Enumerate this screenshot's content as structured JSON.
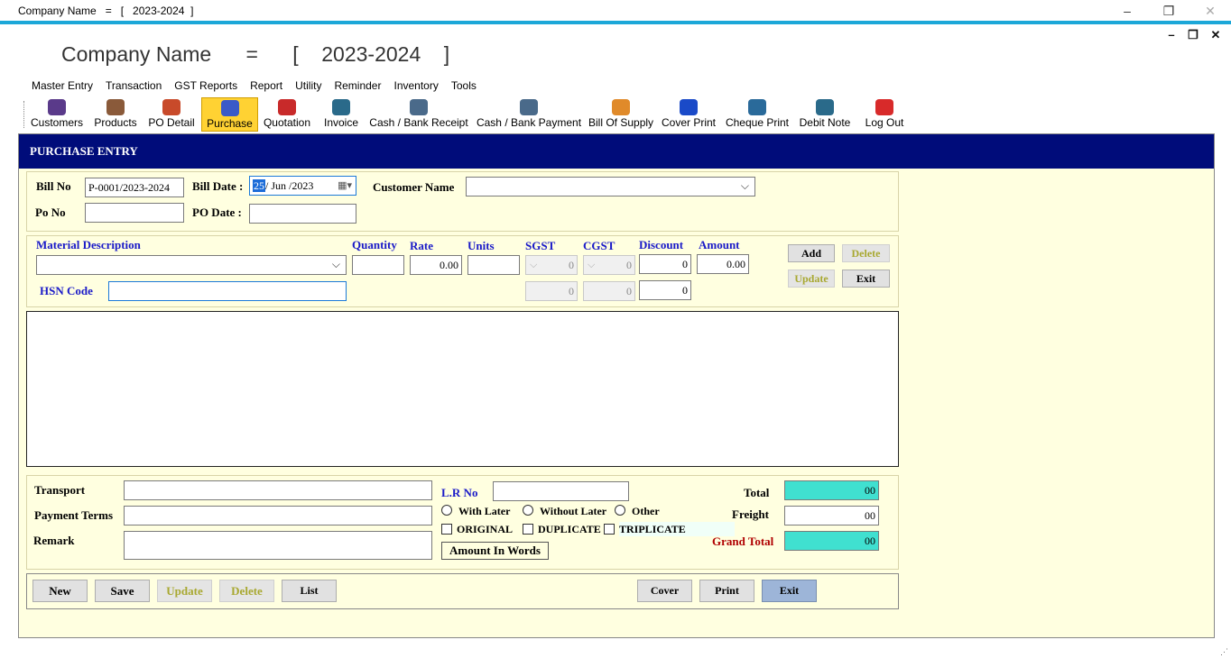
{
  "window": {
    "title": "Company Name   =   [   2023-2024  ]",
    "big_title": "Company Name      =      [    2023-2024    ]"
  },
  "menu": [
    "Master Entry",
    "Transaction",
    "GST Reports",
    "Report",
    "Utility",
    "Reminder",
    "Inventory",
    "Tools"
  ],
  "toolbar": [
    {
      "label": "Customers",
      "icon": "customers-icon",
      "color": "#5a3a8a"
    },
    {
      "label": "Products",
      "icon": "products-icon",
      "color": "#8a5a3a"
    },
    {
      "label": "PO Detail",
      "icon": "po-detail-icon",
      "color": "#c84a2a"
    },
    {
      "label": "Purchase",
      "icon": "cart-icon",
      "color": "#3a5ac8"
    },
    {
      "label": "Quotation",
      "icon": "quotation-icon",
      "color": "#c82a2a"
    },
    {
      "label": "Invoice",
      "icon": "invoice-icon",
      "color": "#2a6a8a"
    },
    {
      "label": "Cash / Bank Receipt",
      "icon": "receipt-icon",
      "color": "#4a6a8a"
    },
    {
      "label": "Cash / Bank Payment",
      "icon": "payment-icon",
      "color": "#4a6a8a"
    },
    {
      "label": "Bill Of Supply",
      "icon": "bill-supply-icon",
      "color": "#e08a2a"
    },
    {
      "label": "Cover Print",
      "icon": "cover-print-icon",
      "color": "#1a4ac8"
    },
    {
      "label": "Cheque Print",
      "icon": "cheque-print-icon",
      "color": "#2a6a9a"
    },
    {
      "label": "Debit Note",
      "icon": "debit-note-icon",
      "color": "#2a6a8a"
    },
    {
      "label": "Log Out",
      "icon": "power-icon",
      "color": "#d82a2a"
    }
  ],
  "form": {
    "header": "PURCHASE ENTRY",
    "bill_no_label": "Bill No",
    "bill_no": "P-0001/2023-2024",
    "bill_date_label": "Bill Date :",
    "bill_date_day": "25",
    "bill_date_rest": "/ Jun /2023",
    "customer_name_label": "Customer Name",
    "customer_name": "",
    "po_no_label": "Po No",
    "po_no": "",
    "po_date_label": "PO Date :",
    "po_date": ""
  },
  "items": {
    "material_description_label": "Material Description",
    "quantity_label": "Quantity",
    "rate_label": "Rate",
    "units_label": "Units",
    "sgst_label": "SGST",
    "cgst_label": "CGST",
    "discount_label": "Discount",
    "amount_label": "Amount",
    "hsn_code_label": "HSN Code",
    "rate": "0.00",
    "sgst": "0",
    "cgst": "0",
    "sgst_amount": "0",
    "cgst_amount": "0",
    "discount": "0",
    "discount_amount": "0",
    "amount": "0.00",
    "add_label": "Add",
    "delete_label": "Delete",
    "update_label": "Update",
    "exit_label": "Exit"
  },
  "footer": {
    "transport_label": "Transport",
    "payment_terms_label": "Payment Terms",
    "remark_label": "Remark",
    "lr_no_label": "L.R  No",
    "with_later": "With Later",
    "without_later": "Without Later",
    "other": "Other",
    "original": "ORIGINAL",
    "duplicate": "DUPLICATE",
    "triplicate": "TRIPLICATE",
    "amount_in_words": "Amount In Words",
    "total_label": "Total",
    "freight_label": "Freight",
    "grand_total_label": "Grand Total",
    "total": "00",
    "freight": "00",
    "grand_total": "00"
  },
  "actions": {
    "new": "New",
    "save": "Save",
    "update": "Update",
    "delete": "Delete",
    "list": "List",
    "cover": "Cover",
    "print": "Print",
    "exit": "Exit"
  }
}
